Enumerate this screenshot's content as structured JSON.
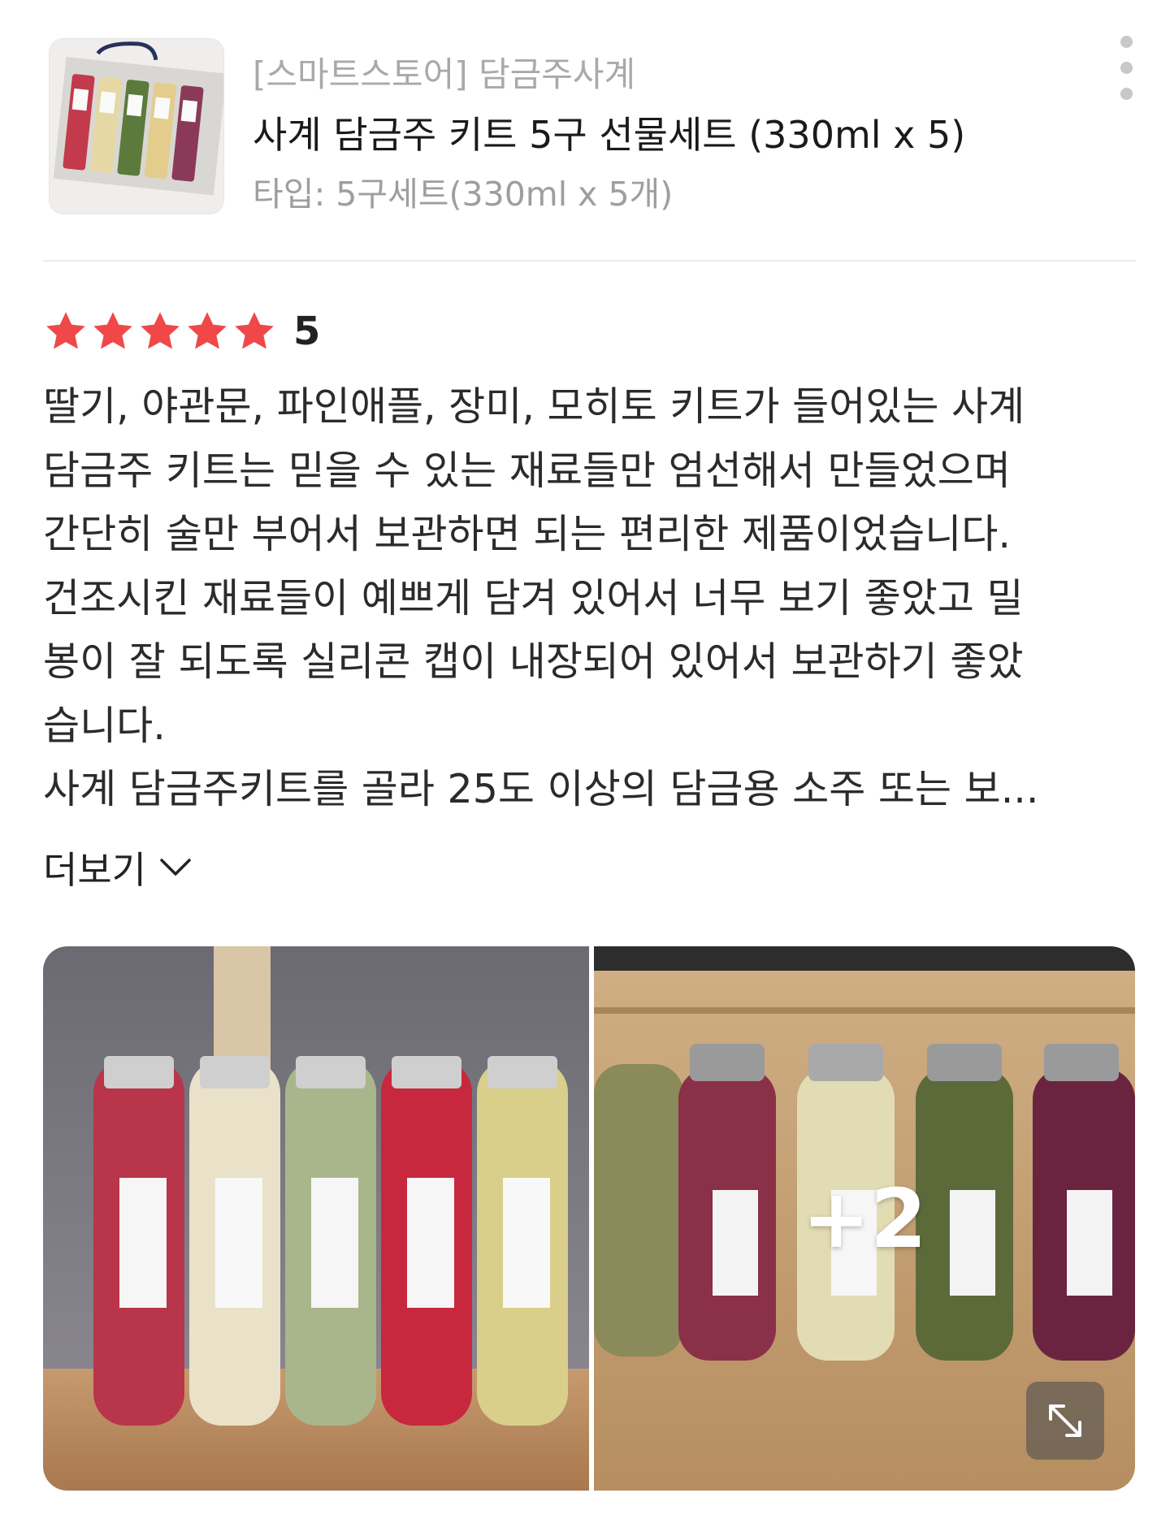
{
  "product": {
    "store_label": "[스마트스토어] 담금주사계",
    "title": "사계 담금주 키트 5구 선물세트 (330ml x 5)",
    "option": "타입: 5구세트(330ml x 5개)",
    "thumbnail_icon": "product-thumbnail"
  },
  "menu": {
    "icon": "more-vertical-icon"
  },
  "review": {
    "rating": 5,
    "rating_label": "5",
    "star_color": "#f04848",
    "lines": [
      "딸기, 야관문, 파인애플, 장미, 모히토 키트가 들어있는 사계",
      "담금주 키트는 믿을 수 있는 재료들만 엄선해서 만들었으며",
      "간단히 술만 부어서 보관하면 되는 편리한 제품이었습니다.",
      "건조시킨 재료들이 예쁘게 담겨 있어서 너무 보기 좋았고 밀",
      "봉이 잘 되도록 실리콘 캡이 내장되어 있어서 보관하기 좋았",
      "습니다.",
      "사계 담금주키트를 골라 25도 이상의 담금용 소주 또는 보..."
    ],
    "more_label": "더보기"
  },
  "gallery": {
    "extra_count_label": "+2",
    "expand_icon": "expand-icon"
  }
}
